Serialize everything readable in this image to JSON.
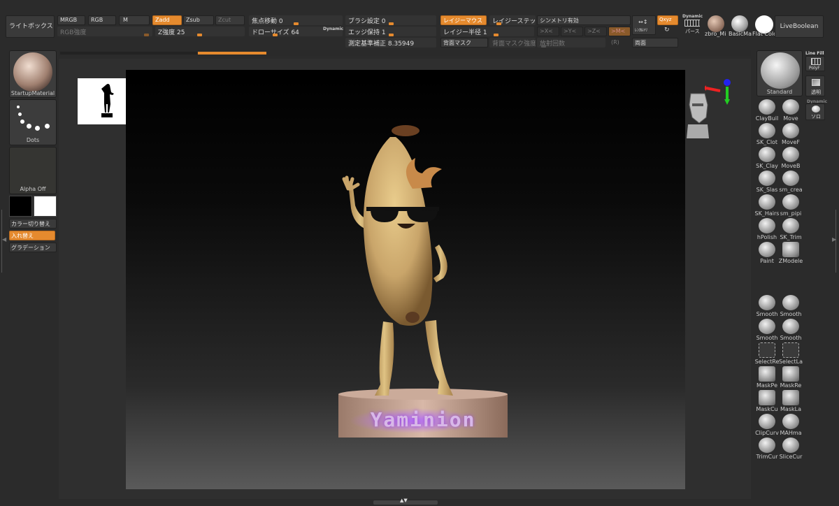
{
  "top": {
    "lightbox": "ライトボックス",
    "mrgb": "MRGB",
    "rgb": "RGB",
    "m": "M",
    "rgb_intensity": "RGB強度",
    "zadd": "Zadd",
    "zsub": "Zsub",
    "zcut": "Zcut",
    "z_intensity_label": "Z強度",
    "z_intensity_value": "25",
    "z_intensity_fraction": 0.5,
    "focal_label": "焦点移動",
    "focal_value": "0",
    "draw_size_label": "ドローサイズ",
    "draw_size_value": "64",
    "dynamic": "Dynamic",
    "brush_setting_label": "ブラシ設定",
    "brush_setting_value": "0",
    "edge_keep_label": "エッジ保持",
    "edge_keep_value": "1",
    "measure_label": "測定基準補正",
    "measure_value": "8.35949",
    "lazy_mouse": "レイジーマウス",
    "lazy_step": "レイジーステップ",
    "lazy_radius_label": "レイジー半径",
    "lazy_radius_value": "1",
    "back_mask": "背面マスク",
    "back_mask_intensity": "背面マスク強度",
    "radial_count": "放射回数",
    "symmetry": "シンメトリ有効",
    "x_axis": ">X<",
    "y_axis": ">Y<",
    "z_axis": ">Z<",
    "m_axis": ">M<",
    "r_label": "(R)",
    "both_sides": "両面",
    "local_sym": "ﾚﾝｶﾙﾄﾘ",
    "xyz": "Qxyz",
    "dynamic2": "Dynamic",
    "perse": "パース",
    "mat1": "zbro_Mi",
    "mat2": "BasicMa",
    "mat3": "Flat Colo",
    "liveboolean": "LiveBoolean"
  },
  "left": {
    "material": "StartupMaterial",
    "stroke": "Dots",
    "alpha": "Alpha Off",
    "color_switch": "カラー切り替え",
    "swap": "入れ替え",
    "gradient": "グラデーション"
  },
  "right": {
    "standard": "Standard",
    "linefill": "Line Fill",
    "polyf": "PolyF",
    "transp": "透明",
    "dynamic": "Dynamic",
    "solo": "ソロ",
    "brushes": [
      {
        "label": "ClayBuil",
        "icon": "claybuildup-icon"
      },
      {
        "label": "Move",
        "icon": "move-icon"
      },
      {
        "label": "SK_Clot",
        "icon": "sk-cloth-icon"
      },
      {
        "label": "MoveF",
        "icon": "move-f-icon"
      },
      {
        "label": "SK_Clay",
        "icon": "sk-clay-icon"
      },
      {
        "label": "MoveB",
        "icon": "move-b-icon"
      },
      {
        "label": "SK_Slas",
        "icon": "sk-slash-icon"
      },
      {
        "label": "sm_crea",
        "icon": "sm-crease-icon"
      },
      {
        "label": "SK_Hairs",
        "icon": "sk-hair-icon"
      },
      {
        "label": "sm_pipi",
        "icon": "sm-piping-icon"
      },
      {
        "label": "hPolish",
        "icon": "hpolish-icon"
      },
      {
        "label": "SK_Trim",
        "icon": "sk-trim-icon"
      },
      {
        "label": "Paint",
        "icon": "paint-icon"
      },
      {
        "label": "ZModele",
        "icon": "zmodeler-icon"
      }
    ],
    "brushes2": [
      {
        "label": "Smooth",
        "icon": "smooth-icon"
      },
      {
        "label": "Smooth",
        "icon": "smooth-icon"
      },
      {
        "label": "Smooth",
        "icon": "smooth-icon"
      },
      {
        "label": "Smooth",
        "icon": "smooth-icon"
      },
      {
        "label": "SelectRe",
        "icon": "select-rect-icon"
      },
      {
        "label": "SelectLa",
        "icon": "select-lasso-icon"
      },
      {
        "label": "MaskPe",
        "icon": "mask-pen-icon"
      },
      {
        "label": "MaskRe",
        "icon": "mask-rect-icon"
      },
      {
        "label": "MaskCu",
        "icon": "mask-curve-icon"
      },
      {
        "label": "MaskLa",
        "icon": "mask-lasso-icon"
      },
      {
        "label": "ClipCurv",
        "icon": "clip-curve-icon"
      },
      {
        "label": "MAHma",
        "icon": "mahma-icon"
      },
      {
        "label": "TrimCur",
        "icon": "trim-curve-icon"
      },
      {
        "label": "SliceCur",
        "icon": "slice-curve-icon"
      }
    ]
  },
  "canvas": {
    "plaque_text": "Yaminion"
  },
  "colors": {
    "accent": "#e58a2e",
    "banana": "#c9a56a",
    "plaque_glow": "#9b4fd6"
  }
}
